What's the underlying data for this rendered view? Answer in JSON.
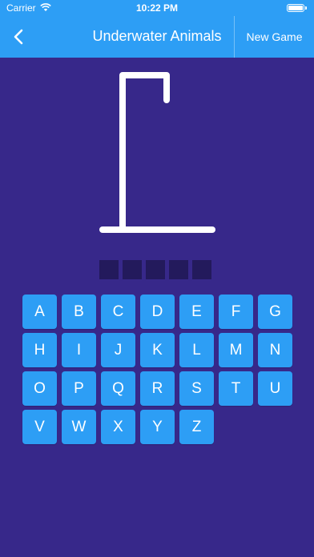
{
  "status_bar": {
    "carrier": "Carrier",
    "time": "10:22 PM"
  },
  "nav": {
    "title": "Underwater Animals",
    "new_game_label": "New Game",
    "back_icon": "chevron-left-icon"
  },
  "colors": {
    "background": "#37288a",
    "accent": "#2d9ef5",
    "slot": "#231a5c",
    "text": "#ffffff"
  },
  "word": {
    "letter_count": 5,
    "revealed": [
      "",
      "",
      "",
      "",
      ""
    ]
  },
  "keyboard": {
    "keys": [
      "A",
      "B",
      "C",
      "D",
      "E",
      "F",
      "G",
      "H",
      "I",
      "J",
      "K",
      "L",
      "M",
      "N",
      "O",
      "P",
      "Q",
      "R",
      "S",
      "T",
      "U",
      "V",
      "W",
      "X",
      "Y",
      "Z"
    ]
  }
}
